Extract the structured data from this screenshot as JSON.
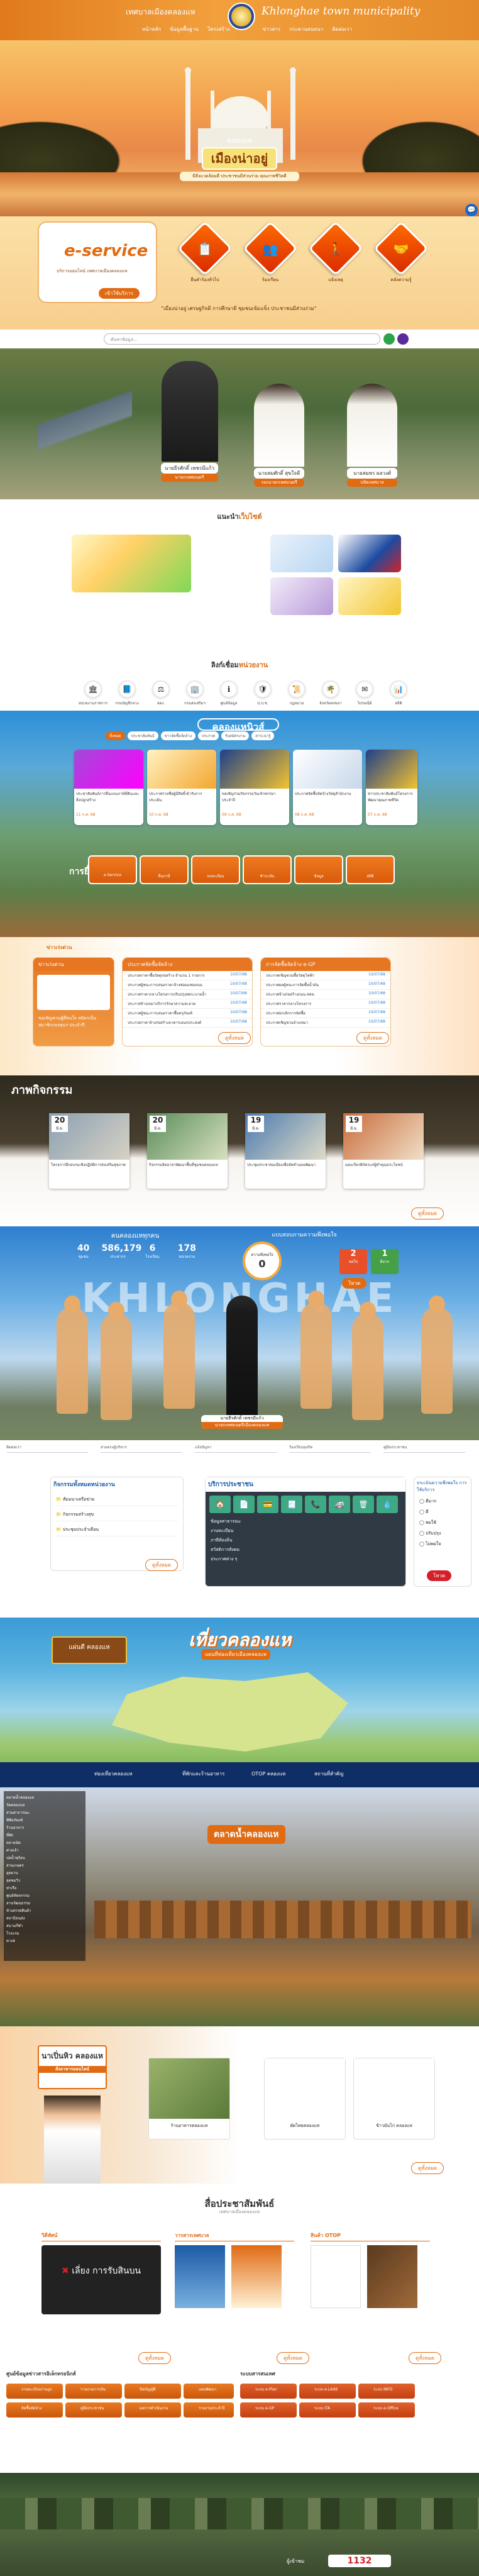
{
  "header": {
    "org_th": "เทศบาลเมืองคลองแห",
    "org_en": "Khlonghae town municipality",
    "nav_left": [
      "หน้าหลัก",
      "ข้อมูลพื้นฐาน",
      "โครงสร้าง"
    ],
    "nav_right": [
      "ข่าวสาร",
      "กระดานสนทนา",
      "ติดต่อเรา"
    ]
  },
  "hero": {
    "welcome": "คลองแห",
    "city": "เมืองน่าอยู่",
    "slogan": "มีสิ่งแวดล้อมดี ประชาชนมีส่วนร่วม คุณภาพชีวิตดี",
    "eservice_title": "e-service",
    "eservice_desc": "บริการออนไลน์ เทศบาลเมืองคลองแห",
    "eservice_btn": "เข้าใช้บริการ",
    "services": [
      {
        "label": "ยื่นคำร้องทั่วไป",
        "icon": "📋"
      },
      {
        "label": "ร้องเรียน",
        "icon": "👥"
      },
      {
        "label": "แจ้งเหตุ",
        "icon": "🚶"
      },
      {
        "label": "คลังความรู้",
        "icon": "🤝"
      }
    ],
    "quote": "\"เมืองน่าอยู่ เศรษฐกิจดี การศึกษาดี ชุมชนเข้มแข็ง ประชาชนมีส่วนร่วม\""
  },
  "search": {
    "placeholder": "ค้นหาข้อมูล..."
  },
  "executives": [
    {
      "name": "นายธีรศักดิ์ เพชรมีแก้ว",
      "role": "นายกเทศมนตรี"
    },
    {
      "name": "นายสมศักดิ์ สุขใจดี",
      "role": "รองนายกเทศมนตรี"
    },
    {
      "name": "นายสมพร ผลวงศ์",
      "role": "ปลัดเทศบาล"
    }
  ],
  "reco": {
    "title_black": "แนะนำ",
    "title_orange": "เว็บไซต์"
  },
  "links": {
    "title_black": "ลิงก์เชื่อม",
    "title_orange": "หน่วยงาน",
    "items": [
      {
        "label": "หน่วยงานราชการ",
        "icon": "🏛"
      },
      {
        "label": "กรมบัญชีกลาง",
        "icon": "📘"
      },
      {
        "label": "สตง.",
        "icon": "⚖"
      },
      {
        "label": "กรมส่งเสริมฯ",
        "icon": "🏢"
      },
      {
        "label": "ศูนย์ข้อมูล",
        "icon": "ℹ"
      },
      {
        "label": "ป.ป.ช.",
        "icon": "🛡"
      },
      {
        "label": "กฎหมาย",
        "icon": "📜"
      },
      {
        "label": "จังหวัดสงขลา",
        "icon": "🌴"
      },
      {
        "label": "ไปรษณีย์",
        "icon": "✉"
      },
      {
        "label": "สถิติ",
        "icon": "📊"
      }
    ]
  },
  "news": {
    "title": "คลองแหนิวส์",
    "tabs": [
      "ทั้งหมด",
      "ประชาสัมพันธ์",
      "ข่าวจัดซื้อจัดจ้าง",
      "ประกาศ",
      "รับสมัครงาน",
      "สาระน่ารู้"
    ],
    "cards": [
      {
        "text": "ประชาสัมพันธ์การยื่นแบบภาษีที่ดินและสิ่งปลูกสร้าง",
        "date": "11 ก.ค. 68"
      },
      {
        "text": "ประกาศรายชื่อผู้มีสิทธิ์เข้ารับการประเมิน",
        "date": "10 ก.ค. 68"
      },
      {
        "text": "ขอเชิญร่วมกิจกรรมวันเข้าพรรษา ประจำปี",
        "date": "09 ก.ค. 68"
      },
      {
        "text": "ประกาศจัดซื้อจัดจ้างวัสดุสำนักงาน",
        "date": "08 ก.ค. 68"
      },
      {
        "text": "ข่าวประชาสัมพันธ์โครงการพัฒนาคุณภาพชีวิต",
        "date": "07 ก.ค. 68"
      }
    ],
    "eservice_label": "การยื่นเอกสาร",
    "ebuttons": [
      "e-Service",
      "ยื่นภาษี",
      "ลงทะเบียน",
      "ชำระเงิน",
      "ข้อมูล",
      "สถิติ"
    ]
  },
  "announce": {
    "pin_label": "ข่าวเร่งด่วน",
    "box1_title": "ข่าวเร่งด่วน",
    "box1_text": "ขอเชิญชวนผู้ที่สนใจ สมัครเป็นสมาชิกกองทุนฯ ประจำปี",
    "box2_title": "ประกาศจัดซื้อจัดจ้าง",
    "box2_items": [
      "ประกวดราคาซื้อวัสดุก่อสร้าง จำนวน 1 รายการ",
      "ประกาศผู้ชนะการเสนอราคาจ้างซ่อมแซมถนน",
      "ประกาศราคากลางโครงการปรับปรุงท่อระบายน้ำ",
      "ประกาศจ้างเหมาบริการรักษาความสะอาด",
      "ประกาศผู้ชนะการเสนอราคาซื้อครุภัณฑ์",
      "ประกวดราคาจ้างก่อสร้างอาคารเอนกประสงค์"
    ],
    "box2_date": "10/07/68",
    "box3_title": "การจัดซื้อจัดจ้าง e-GP",
    "box3_items": [
      "ประกาศเชิญชวนซื้อวัสดุไฟฟ้า",
      "ประกาศผลผู้ชนะการจัดซื้อน้ำมัน",
      "ประกาศจ้างก่อสร้างถนน คสล.",
      "ประกาศราคากลางโครงการ",
      "ประกาศยกเลิกการจัดซื้อ",
      "ประกาศเชิญชวนจ้างเหมา"
    ],
    "more": "ดูทั้งหมด"
  },
  "activities": {
    "title": "ภาพกิจกรรม",
    "items": [
      {
        "day": "20",
        "month": "มิ.ย.",
        "text": "โครงการฝึกอบรมเชิงปฏิบัติการส่งเสริมสุขภาพ"
      },
      {
        "day": "20",
        "month": "มิ.ย.",
        "text": "กิจกรรมจิตอาสาพัฒนาพื้นที่ชุมชนคลองแห"
      },
      {
        "day": "19",
        "month": "มิ.ย.",
        "text": "ประชุมประชาคมเมืองเพื่อจัดทำแผนพัฒนา"
      },
      {
        "day": "19",
        "month": "มิ.ย.",
        "text": "มอบเกียรติบัตรแก่ผู้ทำคุณประโยชน์"
      }
    ],
    "more": "ดูทั้งหมด"
  },
  "stats": {
    "title": "คนคลองแหทุกคน",
    "values": [
      {
        "num": "40",
        "label": "ชุมชน"
      },
      {
        "num": "586,179",
        "label": "ประชากร"
      },
      {
        "num": "6",
        "label": "โรงเรียน"
      },
      {
        "num": "178",
        "label": "หน่วยงาน"
      }
    ],
    "poll_title": "แบบสอบถามความพึงพอใจ",
    "poll_center_label": "ความพึงพอใจ",
    "poll_center": "0",
    "poll_vals": [
      {
        "num": "2",
        "label": "พอใจ"
      },
      {
        "num": "1",
        "label": "ดีมาก"
      }
    ],
    "poll_btn": "โหวต",
    "big_text": "KHLONGHAE",
    "person_name": "นายธีรศักดิ์ เพชรมีแก้ว",
    "person_role": "นายกเทศมนตรีเมืองคลองแห",
    "strip": [
      "ติดต่อเรา",
      "สายตรงผู้บริหาร",
      "แจ้งปัญหา",
      "ร้องเรียนทุจริต",
      "คู่มือประชาชน"
    ]
  },
  "internal": {
    "box1_title": "กิจกรรมทั้งหมดหน่วยงาน",
    "box1_items": [
      "สัมมนาเครือข่าย",
      "กิจกรรมสร้างสุข",
      "ประชุมประจำเดือน"
    ],
    "box2_title": "บริการประชาชน",
    "box2_items": [
      "ข้อมูลสาธารณะ",
      "งานทะเบียน",
      "ภาษีท้องถิ่น",
      "สวัสดิการสังคม",
      "ประกาศต่าง ๆ"
    ],
    "box3_title": "ประเมินความพึงพอใจ การใช้บริการ",
    "box3_opts": [
      "ดีมาก",
      "ดี",
      "พอใช้",
      "ปรับปรุง",
      "ไม่พอใจ"
    ],
    "box3_btn": "โหวต",
    "more": "ดูทั้งหมด"
  },
  "map": {
    "title": "เที่ยวคลองแห",
    "subtitle": "แผนที่ท่องเที่ยวเมืองคลองแห",
    "sign_title": "แผ่นดี คลองแห",
    "bar": [
      "ท่องเที่ยวคลองแห",
      "ที่พักและร้านอาหาร",
      "OTOP คลองแห",
      "สถานที่สำคัญ"
    ]
  },
  "tourism": {
    "title": "ตลาดน้ำคลองแห",
    "sidebar": [
      "ตลาดน้ำคลองแห",
      "วัดคลองแห",
      "สวนสาธารณะ",
      "พิพิธภัณฑ์",
      "ร้านอาหาร",
      "ที่พัก",
      "ตลาดนัด",
      "ศาลเจ้า",
      "บ่อน้ำพุร้อน",
      "สวนเกษตร",
      "อุทยาน",
      "จุดชมวิว",
      "ท่าเรือ",
      "ศูนย์หัตถกรรม",
      "ลานวัฒนธรรม",
      "ห้างสรรพสินค้า",
      "สถานีขนส่ง",
      "สนามกีฬา",
      "โรงแรม",
      "คาเฟ่"
    ]
  },
  "ad": {
    "title": "นาเปิ่นหิว คลองแห",
    "subtitle": "สั่งอาหารออนไลน์",
    "pics": [
      "ร้านอาหารคลองแห",
      "ผัดไทยคลองแห",
      "ข้าวมันไก่ คลองแห"
    ],
    "more": "ดูทั้งหมด"
  },
  "media": {
    "title": "สื่อประชาสัมพันธ์",
    "subtitle": "เทศบาลเมืองคลองแห",
    "col1": "วิดีทัศน์",
    "col2": "วารสารเทศบาล",
    "col3": "สินค้า OTOP",
    "video_title": "เลี่ยง การรับสินบน",
    "more": "ดูทั้งหมด",
    "left_title": "ศูนย์ข้อมูลข่าวสารอิเล็กทรอนิกส์",
    "right_title": "ระบบสารสนเทศ",
    "left_btns": [
      "งานทะเบียนราษฎร",
      "รายงานการเงิน",
      "ข้อบัญญัติ",
      "แผนพัฒนา",
      "จัดซื้อจัดจ้าง",
      "คู่มือประชาชน",
      "ผลการดำเนินงาน",
      "รายงานประจำปี"
    ],
    "right_btns": [
      "ระบบ e-Plan",
      "ระบบ e-LAAS",
      "ระบบ INFO",
      "ระบบ e-GP",
      "ระบบ ITA",
      "ระบบ e-Office"
    ]
  },
  "footer": {
    "counter": "1132",
    "label": "ผู้เข้าชม"
  }
}
